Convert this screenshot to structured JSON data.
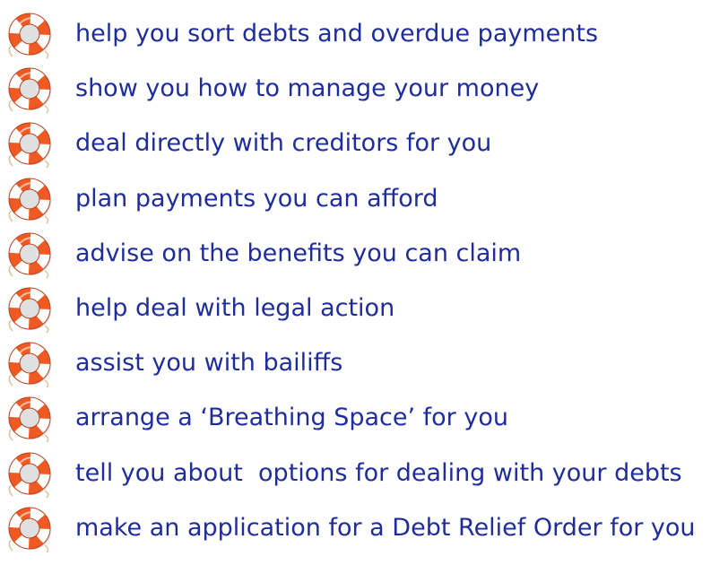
{
  "icon_name": "lifebuoy-icon",
  "colors": {
    "text": "#1f2d9c",
    "buoy_orange": "#ef5a24",
    "buoy_white": "#ffffff",
    "rope": "#d9c7a3"
  },
  "items": [
    "help you sort debts and overdue payments",
    "show you how to manage your money",
    "deal directly with creditors for you",
    "plan payments you can afford",
    "advise on the benefits you can claim",
    "help deal with legal action",
    "assist you with bailiffs",
    "arrange a ‘Breathing Space’ for you",
    "tell you about  options for dealing with your debts",
    "make an application for a Debt Relief Order for you"
  ]
}
